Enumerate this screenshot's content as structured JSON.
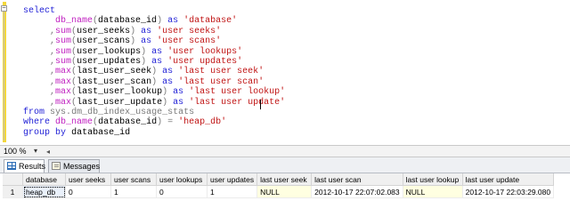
{
  "editor": {
    "lines": [
      {
        "parts": [
          {
            "t": "select",
            "c": "kw"
          }
        ]
      },
      {
        "parts": [
          {
            "t": "      "
          },
          {
            "t": "db_name",
            "c": "fn"
          },
          {
            "t": "(",
            "c": "gr"
          },
          {
            "t": "database_id"
          },
          {
            "t": ")",
            "c": "gr"
          },
          {
            "t": " "
          },
          {
            "t": "as",
            "c": "kw"
          },
          {
            "t": " "
          },
          {
            "t": "'database'",
            "c": "str"
          }
        ]
      },
      {
        "parts": [
          {
            "t": "     "
          },
          {
            "t": ",",
            "c": "gr"
          },
          {
            "t": "sum",
            "c": "fn"
          },
          {
            "t": "(",
            "c": "gr"
          },
          {
            "t": "user_seeks"
          },
          {
            "t": ")",
            "c": "gr"
          },
          {
            "t": " "
          },
          {
            "t": "as",
            "c": "kw"
          },
          {
            "t": " "
          },
          {
            "t": "'user seeks'",
            "c": "str"
          }
        ]
      },
      {
        "parts": [
          {
            "t": "     "
          },
          {
            "t": ",",
            "c": "gr"
          },
          {
            "t": "sum",
            "c": "fn"
          },
          {
            "t": "(",
            "c": "gr"
          },
          {
            "t": "user_scans"
          },
          {
            "t": ")",
            "c": "gr"
          },
          {
            "t": " "
          },
          {
            "t": "as",
            "c": "kw"
          },
          {
            "t": " "
          },
          {
            "t": "'user scans'",
            "c": "str"
          }
        ]
      },
      {
        "parts": [
          {
            "t": "     "
          },
          {
            "t": ",",
            "c": "gr"
          },
          {
            "t": "sum",
            "c": "fn"
          },
          {
            "t": "(",
            "c": "gr"
          },
          {
            "t": "user_lookups"
          },
          {
            "t": ")",
            "c": "gr"
          },
          {
            "t": " "
          },
          {
            "t": "as",
            "c": "kw"
          },
          {
            "t": " "
          },
          {
            "t": "'user lookups'",
            "c": "str"
          }
        ]
      },
      {
        "parts": [
          {
            "t": "     "
          },
          {
            "t": ",",
            "c": "gr"
          },
          {
            "t": "sum",
            "c": "fn"
          },
          {
            "t": "(",
            "c": "gr"
          },
          {
            "t": "user_updates"
          },
          {
            "t": ")",
            "c": "gr"
          },
          {
            "t": " "
          },
          {
            "t": "as",
            "c": "kw"
          },
          {
            "t": " "
          },
          {
            "t": "'user updates'",
            "c": "str"
          }
        ]
      },
      {
        "parts": [
          {
            "t": "     "
          },
          {
            "t": ",",
            "c": "gr"
          },
          {
            "t": "max",
            "c": "fn"
          },
          {
            "t": "(",
            "c": "gr"
          },
          {
            "t": "last_user_seek"
          },
          {
            "t": ")",
            "c": "gr"
          },
          {
            "t": " "
          },
          {
            "t": "as",
            "c": "kw"
          },
          {
            "t": " "
          },
          {
            "t": "'last user seek'",
            "c": "str"
          }
        ]
      },
      {
        "parts": [
          {
            "t": "     "
          },
          {
            "t": ",",
            "c": "gr"
          },
          {
            "t": "max",
            "c": "fn"
          },
          {
            "t": "(",
            "c": "gr"
          },
          {
            "t": "last_user_scan"
          },
          {
            "t": ")",
            "c": "gr"
          },
          {
            "t": " "
          },
          {
            "t": "as",
            "c": "kw"
          },
          {
            "t": " "
          },
          {
            "t": "'last user scan'",
            "c": "str"
          }
        ]
      },
      {
        "parts": [
          {
            "t": "     "
          },
          {
            "t": ",",
            "c": "gr"
          },
          {
            "t": "max",
            "c": "fn"
          },
          {
            "t": "(",
            "c": "gr"
          },
          {
            "t": "last_user_lookup"
          },
          {
            "t": ")",
            "c": "gr"
          },
          {
            "t": " "
          },
          {
            "t": "as",
            "c": "kw"
          },
          {
            "t": " "
          },
          {
            "t": "'last user lookup'",
            "c": "str"
          }
        ]
      },
      {
        "parts": [
          {
            "t": "     "
          },
          {
            "t": ",",
            "c": "gr"
          },
          {
            "t": "max",
            "c": "fn"
          },
          {
            "t": "(",
            "c": "gr"
          },
          {
            "t": "last_user_update"
          },
          {
            "t": ")",
            "c": "gr"
          },
          {
            "t": " "
          },
          {
            "t": "as",
            "c": "kw"
          },
          {
            "t": " "
          },
          {
            "t": "'last user update'",
            "c": "str"
          }
        ]
      },
      {
        "parts": [
          {
            "t": "from",
            "c": "kw"
          },
          {
            "t": " "
          },
          {
            "t": "sys",
            "c": "gr"
          },
          {
            "t": ".",
            "c": "gr"
          },
          {
            "t": "dm_db_index_usage_stats",
            "c": "gr"
          }
        ]
      },
      {
        "parts": [
          {
            "t": "where",
            "c": "kw"
          },
          {
            "t": " "
          },
          {
            "t": "db_name",
            "c": "fn"
          },
          {
            "t": "(",
            "c": "gr"
          },
          {
            "t": "database_id"
          },
          {
            "t": ")",
            "c": "gr"
          },
          {
            "t": " "
          },
          {
            "t": "=",
            "c": "gr"
          },
          {
            "t": " "
          },
          {
            "t": "'heap_db'",
            "c": "str"
          }
        ]
      },
      {
        "parts": [
          {
            "t": "group",
            "c": "kw"
          },
          {
            "t": " "
          },
          {
            "t": "by",
            "c": "kw"
          },
          {
            "t": " "
          },
          {
            "t": "database_id"
          }
        ]
      }
    ]
  },
  "zoom": {
    "value": "100 %",
    "arrow": "▾",
    "scroll_left": "◂"
  },
  "tabs": [
    {
      "label": "Results",
      "icon": "results-grid-icon",
      "active": true
    },
    {
      "label": "Messages",
      "icon": "messages-icon",
      "active": false
    }
  ],
  "grid": {
    "headers": [
      "database",
      "user seeks",
      "user scans",
      "user lookups",
      "user updates",
      "last user seek",
      "last user scan",
      "last user lookup",
      "last user update"
    ],
    "rows": [
      {
        "num": "1",
        "cells": [
          "heap_db",
          "0",
          "1",
          "0",
          "1",
          "NULL",
          "2012-10-17 22:07:02.083",
          "NULL",
          "2012-10-17 22:03:29.080"
        ]
      }
    ]
  },
  "colors": {
    "keyword": "#1f1fd6",
    "function": "#c020c0",
    "string": "#c01414",
    "operator": "#7a7a7a",
    "change_bar": "#f4d83a"
  }
}
